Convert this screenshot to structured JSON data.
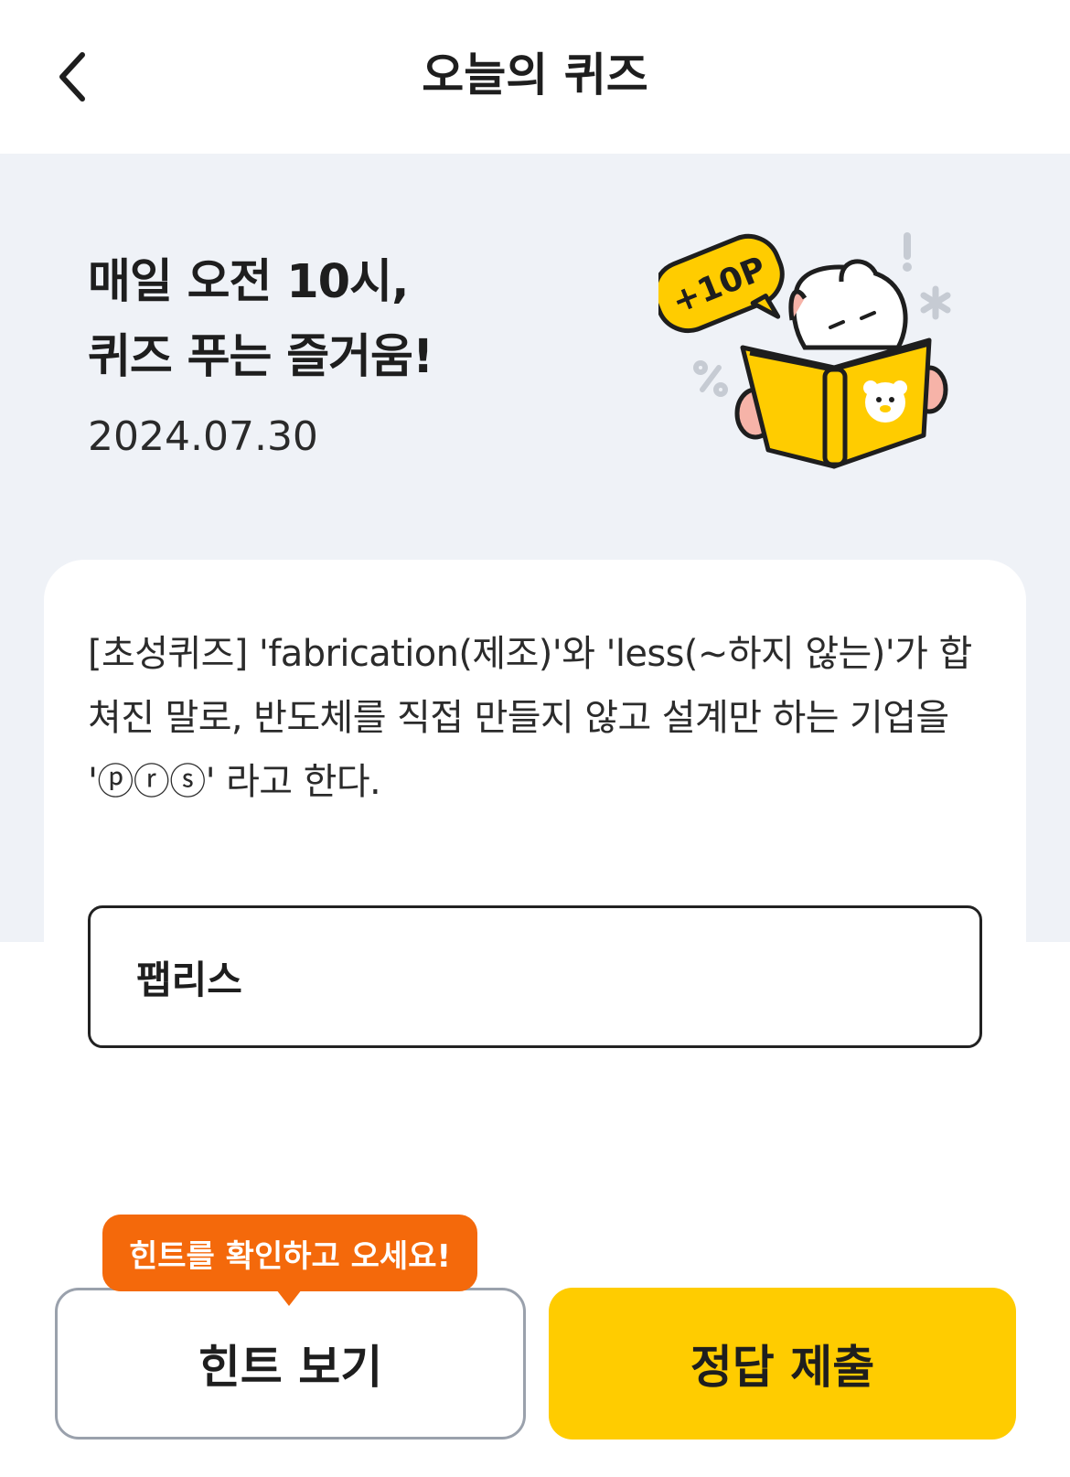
{
  "header": {
    "back_icon": "chevron-left-icon",
    "title": "오늘의 퀴즈"
  },
  "hero": {
    "title_line1": "매일 오전 10시,",
    "title_line2": "퀴즈 푸는 즐거움!",
    "date": "2024.07.30",
    "badge": "+10P",
    "illustration": "rabbit-reading-book"
  },
  "quiz": {
    "question": "[초성퀴즈] 'fabrication(제조)'와 'less(~하지 않는)'가 합쳐진 말로, 반도체를 직접 만들지 않고 설계만 하는 기업을 'ⓟⓡⓢ' 라고 한다.",
    "answer_value": "팹리스"
  },
  "actions": {
    "hint_tooltip": "힌트를 확인하고 오세요!",
    "hint_label": "힌트 보기",
    "submit_label": "정답 제출"
  },
  "colors": {
    "accent": "#ffcc00",
    "tooltip": "#f4690b",
    "hero_bg": "#eff2f7"
  }
}
